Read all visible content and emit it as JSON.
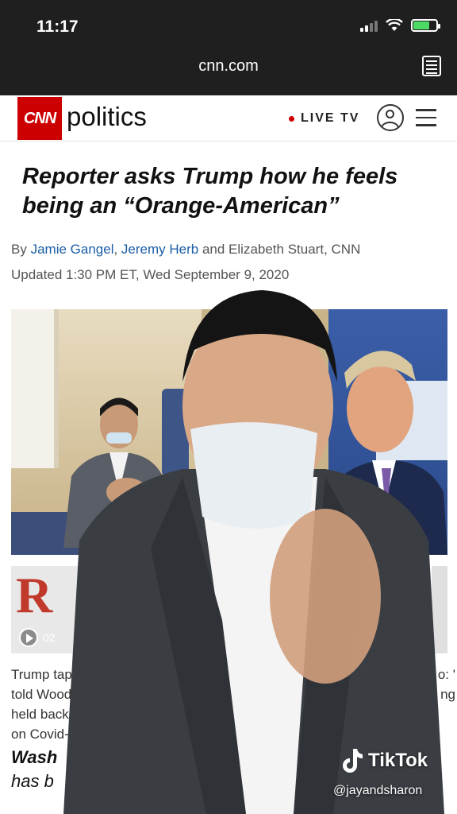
{
  "status": {
    "time": "11:17"
  },
  "browser": {
    "url": "cnn.com"
  },
  "cnn": {
    "logo": "CNN",
    "section": "politics",
    "live": "LIVE TV"
  },
  "article": {
    "headline": "Reporter asks Trump how he feels being an “Orange-American”",
    "byline_prefix": "By",
    "author1": "Jamie Gangel",
    "author2": "Jeremy Herb",
    "author_rest": "and Elizabeth Stuart, CNN",
    "updated": "Updated 1:30 PM ET, Wed September 9, 2020"
  },
  "related": {
    "thumb_letter": "R",
    "duration": "02",
    "lines": [
      "Trump tapes",
      "told Woodw",
      "held back f",
      "on Covid-1"
    ],
    "right_lines": [
      "o: '",
      "ng"
    ]
  },
  "teaser": {
    "line1": "Wash",
    "line2": "has b"
  },
  "overlay": {
    "brand": "TikTok",
    "handle": "@jayandsharon"
  },
  "colors": {
    "cnn_red": "#cc0000",
    "link_blue": "#1a5ea6",
    "battery_green": "#4cd964"
  },
  "icons": [
    "signal-icon",
    "wifi-icon",
    "battery-icon",
    "reader-icon",
    "account-icon",
    "menu-icon",
    "play-icon",
    "tiktok-icon"
  ]
}
